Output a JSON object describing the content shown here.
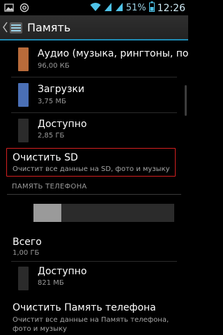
{
  "status": {
    "battery": "51%",
    "time": "12:26"
  },
  "action_bar": {
    "title": "Память"
  },
  "sd_items": [
    {
      "title": "Аудио (музыка, рингтоны, под",
      "sub": "96,00 КБ",
      "color": "#b86b3a"
    },
    {
      "title": "Загрузки",
      "sub": "3,75 МБ",
      "color": "#4a6fb5"
    },
    {
      "title": "Доступно",
      "sub": "2,85 ГБ",
      "color": "#2b2b2b"
    }
  ],
  "clear_sd": {
    "title": "Очистить SD",
    "sub": "Очистит все данные на SD, фото и музыку"
  },
  "phone_section": {
    "header": "ПАМЯТЬ ТЕЛЕФОНА"
  },
  "phone_usage": {
    "used_fraction": 0.2
  },
  "total": {
    "title": "Всего",
    "sub": "1,00 ГБ"
  },
  "phone_available": {
    "title": "Доступно",
    "sub": "821 МБ",
    "color": "#2b2b2b"
  },
  "clear_phone": {
    "title": "Очистить Память телефона",
    "sub": "Очистит все данные на Память телефона, фото и музыку"
  }
}
